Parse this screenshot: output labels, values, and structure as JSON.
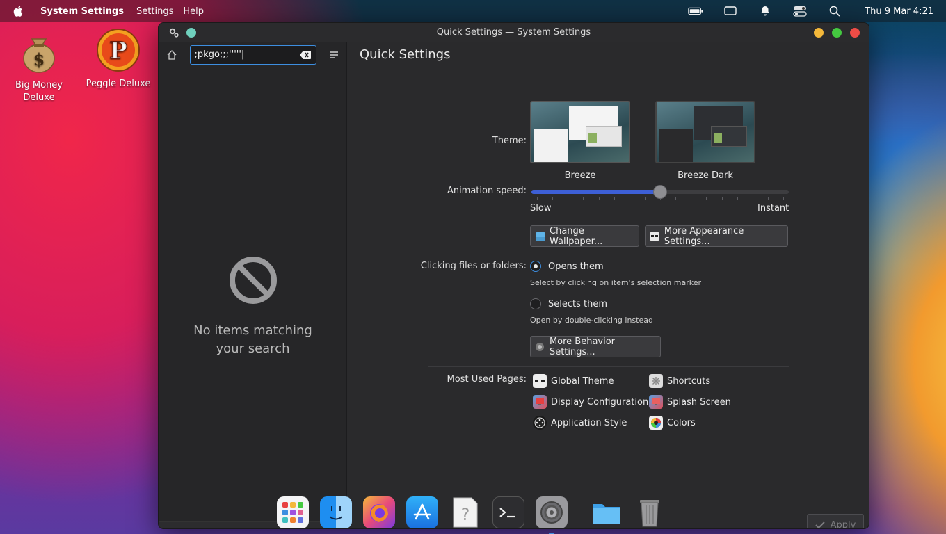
{
  "menubar": {
    "app_name": "System Settings",
    "menus": [
      "Settings",
      "Help"
    ],
    "clock": "Thu 9 Mar 4:21"
  },
  "desktop": {
    "icons": [
      {
        "label": "Big Money\nDeluxe"
      },
      {
        "label": "Peggle Deluxe"
      }
    ]
  },
  "window": {
    "title": "Quick Settings — System Settings"
  },
  "sidebar": {
    "search_value": ";pkgo;;;'''''|",
    "empty_message_line1": "No items matching",
    "empty_message_line2": "your search"
  },
  "main": {
    "header": "Quick Settings",
    "theme": {
      "label": "Theme:",
      "options": [
        {
          "name": "Breeze"
        },
        {
          "name": "Breeze Dark"
        }
      ]
    },
    "animation": {
      "label": "Animation speed:",
      "min_label": "Slow",
      "max_label": "Instant",
      "value_fraction": 0.5
    },
    "buttons": {
      "change_wallpaper": "Change Wallpaper...",
      "more_appearance": "More Appearance Settings...",
      "more_behavior": "More Behavior Settings..."
    },
    "clicking": {
      "label": "Clicking files or folders:",
      "opens_label": "Opens them",
      "opens_hint": "Select by clicking on item's selection marker",
      "selects_label": "Selects them",
      "selects_hint": "Open by double-clicking instead",
      "selected": "opens"
    },
    "most_used": {
      "label": "Most Used Pages:",
      "pages": [
        {
          "name": "Global Theme"
        },
        {
          "name": "Shortcuts"
        },
        {
          "name": "Display Configuration"
        },
        {
          "name": "Splash Screen"
        },
        {
          "name": "Application Style"
        },
        {
          "name": "Colors"
        }
      ]
    },
    "apply_label": "Apply"
  },
  "colors": {
    "accent": "#3d8ee0",
    "slider_fill": "#3d5fd6",
    "window_bg": "#2a2a2c"
  }
}
